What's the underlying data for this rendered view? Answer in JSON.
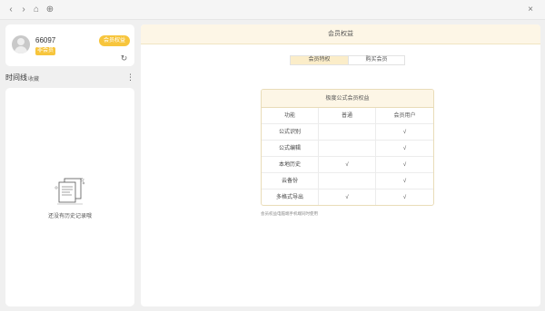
{
  "titlebar": {
    "back_icon": "‹",
    "forward_icon": "›",
    "home_icon": "⌂",
    "help_icon": "⊕",
    "close_icon": "×"
  },
  "profile": {
    "user_id": "66097",
    "badge": "非会员",
    "vip_button": "会员权益",
    "refresh_icon": "↻"
  },
  "timeline": {
    "title": "时间线",
    "subtitle": "收藏",
    "more_icon": "⋮",
    "empty_text": "还没有历史记录哦"
  },
  "main": {
    "header_title": "会员权益",
    "tabs": [
      {
        "label": "会员特权",
        "active": true
      },
      {
        "label": "购买会员",
        "active": false
      }
    ],
    "table": {
      "title": "极度公式会员权益",
      "headers": [
        "功能",
        "普通",
        "会员用户"
      ],
      "rows": [
        [
          "公式识别",
          "",
          "√"
        ],
        [
          "公式编辑",
          "",
          "√"
        ],
        [
          "本地历史",
          "√",
          "√"
        ],
        [
          "云备份",
          "",
          "√"
        ],
        [
          "多格式导出",
          "√",
          "√"
        ]
      ]
    },
    "footnote": "会员权益电脑端手机端同时使用"
  },
  "colors": {
    "accent_yellow": "#f7c53c",
    "header_cream": "#fdf6e6",
    "tab_active": "#fbedc9"
  }
}
